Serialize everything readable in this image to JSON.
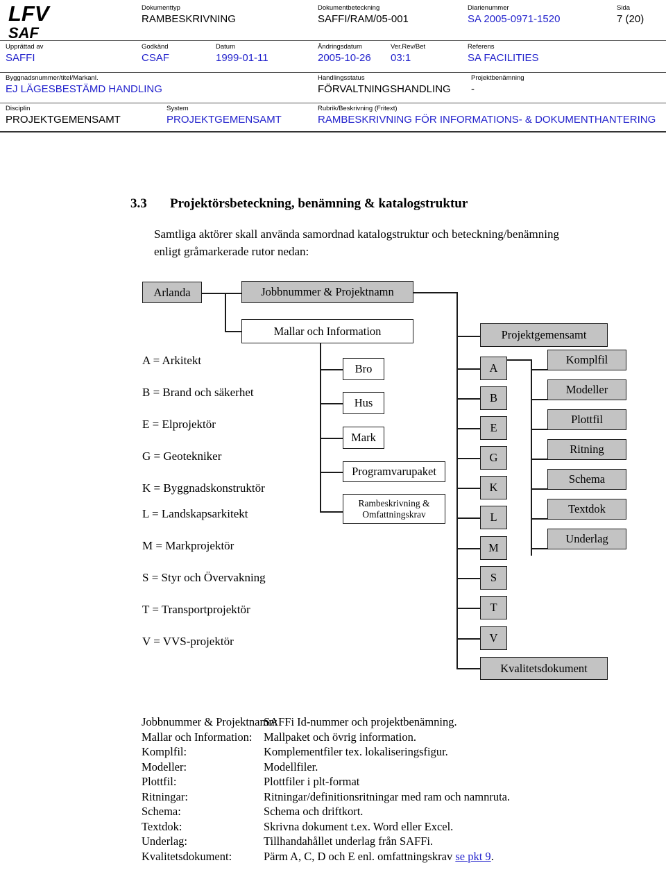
{
  "header": {
    "logo_line1": "LFV",
    "logo_line2": "SAF",
    "fields": [
      {
        "label": "Dokumenttyp",
        "value": "RAMBESKRIVNING",
        "color": "black"
      },
      {
        "label": "Dokumentbeteckning",
        "value": "SAFFI/RAM/05-001",
        "color": "black"
      },
      {
        "label": "Diarienummer",
        "value": "SA 2005-0971-1520",
        "color": "blue"
      },
      {
        "label": "Sida",
        "value": "7 (20)",
        "color": "black"
      },
      {
        "label": "Upprättad av",
        "value": "SAFFI",
        "color": "blue"
      },
      {
        "label": "Godkänd",
        "value": "CSAF",
        "color": "blue"
      },
      {
        "label": "Datum",
        "value": "1999-01-11",
        "color": "blue"
      },
      {
        "label": "Ändringsdatum",
        "value": "2005-10-26",
        "color": "blue"
      },
      {
        "label": "Ver.Rev/Bet",
        "value": "03:1",
        "color": "blue"
      },
      {
        "label": "Referens",
        "value": "SA FACILITIES",
        "color": "blue"
      },
      {
        "label": "Byggnadsnummer/titel/Markanl.",
        "value": "EJ LÄGESBESTÄMD HANDLING",
        "color": "blue"
      },
      {
        "label": "Handlingsstatus",
        "value": "FÖRVALTNINGSHANDLING",
        "color": "black"
      },
      {
        "label": "Projektbenämning",
        "value": "-",
        "color": "black"
      },
      {
        "label": "Disciplin",
        "value": "PROJEKTGEMENSAMT",
        "color": "black"
      },
      {
        "label": "System",
        "value": "PROJEKTGEMENSAMT",
        "color": "blue"
      },
      {
        "label": "Rubrik/Beskrivning (Fritext)",
        "value": "RAMBESKRIVNING FÖR INFORMATIONS- & DOKUMENTHANTERING",
        "color": "blue"
      }
    ]
  },
  "section": {
    "number": "3.3",
    "title": "Projektörsbeteckning, benämning & katalogstruktur",
    "paragraph_line1": "Samtliga aktörer skall använda samordnad katalogstruktur och beteckning/benämning",
    "paragraph_line2": "enligt gråmarkerade rutor nedan:"
  },
  "diagram": {
    "root": "Arlanda",
    "top_nodes": [
      {
        "label": "Jobbnummer & Projektnamn",
        "fill": "gray"
      },
      {
        "label": "Mallar och Information",
        "fill": "white"
      }
    ],
    "project_node": {
      "label": "Projektgemensamt",
      "fill": "gray"
    },
    "template_children": [
      {
        "label": "Bro",
        "fill": "white"
      },
      {
        "label": "Hus",
        "fill": "white"
      },
      {
        "label": "Mark",
        "fill": "white"
      },
      {
        "label": "Programvarupaket",
        "fill": "white"
      },
      {
        "label": "Rambeskrivning &\nOmfattningskrav",
        "fill": "white"
      }
    ],
    "discipline_codes": [
      {
        "label": "A",
        "fill": "gray"
      },
      {
        "label": "B",
        "fill": "gray"
      },
      {
        "label": "E",
        "fill": "gray"
      },
      {
        "label": "G",
        "fill": "gray"
      },
      {
        "label": "K",
        "fill": "gray"
      },
      {
        "label": "L",
        "fill": "gray"
      },
      {
        "label": "M",
        "fill": "gray"
      },
      {
        "label": "S",
        "fill": "gray"
      },
      {
        "label": "T",
        "fill": "gray"
      },
      {
        "label": "V",
        "fill": "gray"
      }
    ],
    "quality_node": {
      "label": "Kvalitetsdokument",
      "fill": "gray"
    },
    "file_types": [
      {
        "label": "Komplfil",
        "fill": "gray"
      },
      {
        "label": "Modeller",
        "fill": "gray"
      },
      {
        "label": "Plottfil",
        "fill": "gray"
      },
      {
        "label": "Ritning",
        "fill": "gray"
      },
      {
        "label": "Schema",
        "fill": "gray"
      },
      {
        "label": "Textdok",
        "fill": "gray"
      },
      {
        "label": "Underlag",
        "fill": "gray"
      }
    ],
    "legend": [
      "A = Arkitekt",
      "B = Brand och säkerhet",
      "E = Elprojektör",
      "G = Geotekniker",
      "K = Byggnadskonstruktör",
      "L = Landskapsarkitekt",
      "M = Markprojektör",
      "S = Styr och Övervakning",
      "T = Transportprojektör",
      "V = VVS-projektör"
    ]
  },
  "definitions": [
    {
      "term": "Jobbnummer & Projektnamn:",
      "desc": "SAFFi Id-nummer och projektbenämning."
    },
    {
      "term": "Mallar och Information:",
      "desc": "Mallpaket och övrig information."
    },
    {
      "term": "Komplfil:",
      "desc": "Komplementfiler tex.  lokaliseringsfigur."
    },
    {
      "term": "Modeller:",
      "desc": "Modellfiler."
    },
    {
      "term": "Plottfil:",
      "desc": "Plottfiler i plt-format"
    },
    {
      "term": "Ritningar:",
      "desc": "Ritningar/definitionsritningar med ram och namnruta."
    },
    {
      "term": "Schema:",
      "desc": "Schema och driftkort."
    },
    {
      "term": "Textdok:",
      "desc": "Skrivna dokument t.ex. Word eller Excel."
    },
    {
      "term": "Underlag:",
      "desc": "Tillhandahållet underlag från SAFFi."
    },
    {
      "term": "Kvalitetsdokument:",
      "desc_prefix": "Pärm A, C, D och E enl. omfattningskrav ",
      "desc_link": "se pkt 9",
      "desc_suffix": "."
    }
  ],
  "colors": {
    "box_gray": "#c3c3c3",
    "link_blue": "#2222cc",
    "line": "#1a1a1a"
  }
}
